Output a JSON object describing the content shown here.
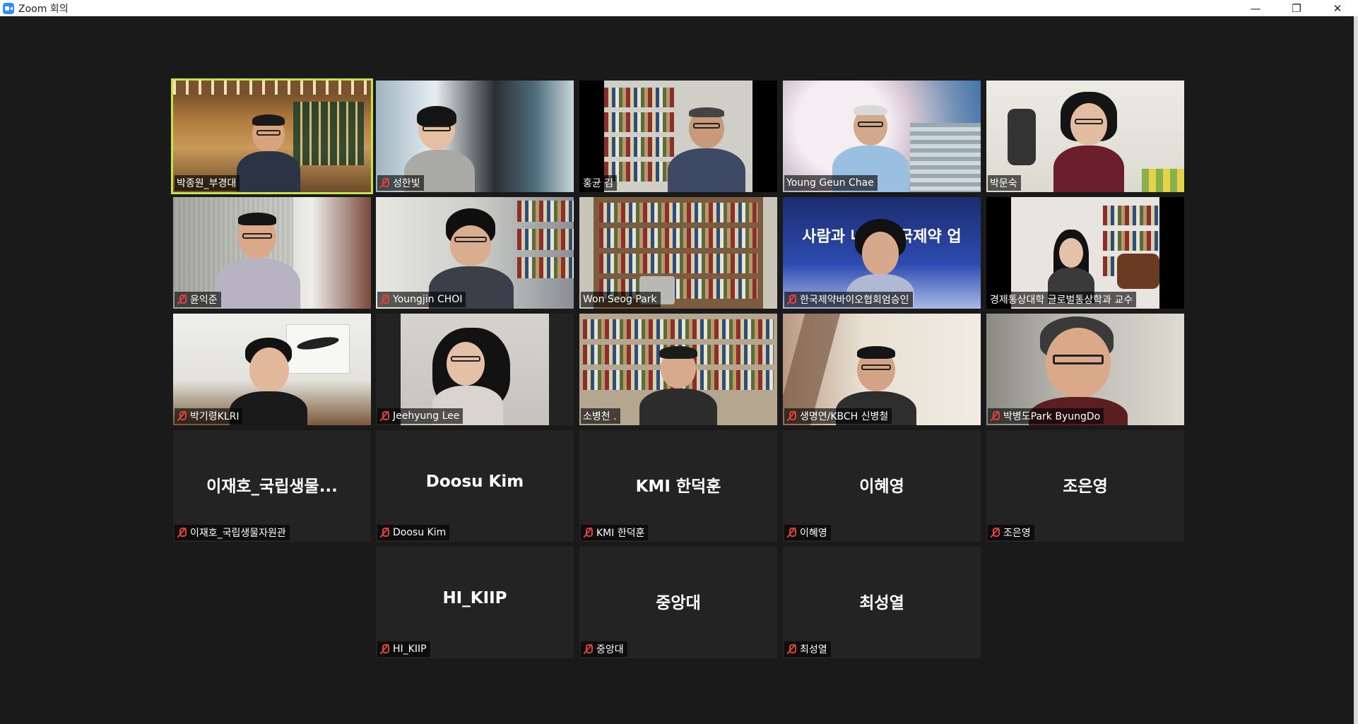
{
  "window": {
    "title": "Zoom 회의",
    "controls": {
      "minimize": "—",
      "restore": "❐",
      "close": "✕"
    }
  },
  "participants": [
    {
      "label": "박종원_부경대",
      "muted": false,
      "video": true,
      "active": true
    },
    {
      "label": "성한빛",
      "muted": true,
      "video": true
    },
    {
      "label": "홍균 김",
      "muted": false,
      "video": true
    },
    {
      "label": "Young Geun Chae",
      "muted": false,
      "video": true
    },
    {
      "label": "박문숙",
      "muted": false,
      "video": true
    },
    {
      "label": "윤익준",
      "muted": true,
      "video": true
    },
    {
      "label": "Youngjin CHOI",
      "muted": true,
      "video": true
    },
    {
      "label": "Won Seog Park",
      "muted": false,
      "video": true
    },
    {
      "label": "한국제약바이오협회엄승인",
      "muted": true,
      "video": true,
      "background_text": "사람과 내일 한국제약 업"
    },
    {
      "label": "경제통상대학 글로벌통상학과 교수",
      "muted": false,
      "video": true
    },
    {
      "label": "박기령KLRI",
      "muted": true,
      "video": true
    },
    {
      "label": "Jeehyung Lee",
      "muted": true,
      "video": true
    },
    {
      "label": "소병천 .",
      "muted": false,
      "video": true
    },
    {
      "label": "생명연/KBCH 신병철",
      "muted": true,
      "video": true
    },
    {
      "label": "박병도Park ByungDo",
      "muted": true,
      "video": true
    },
    {
      "label": "이재호_국립생물자원관",
      "display": "이재호_국립생물...",
      "muted": true,
      "video": false
    },
    {
      "label": "Doosu Kim",
      "display": "Doosu Kim",
      "muted": true,
      "video": false
    },
    {
      "label": "KMI 한덕훈",
      "display": "KMI 한덕훈",
      "muted": true,
      "video": false
    },
    {
      "label": "이혜영",
      "display": "이혜영",
      "muted": true,
      "video": false
    },
    {
      "label": "조은영",
      "display": "조은영",
      "muted": true,
      "video": false
    },
    {
      "label": "HI_KIIP",
      "display": "HI_KIIP",
      "muted": true,
      "video": false
    },
    {
      "label": "중앙대",
      "display": "중앙대",
      "muted": true,
      "video": false
    },
    {
      "label": "최성열",
      "display": "최성열",
      "muted": true,
      "video": false
    }
  ],
  "colors": {
    "active_border": "#c6e346",
    "muted_icon": "#e0413a",
    "background": "#1a1a1a",
    "tile": "#232323"
  }
}
